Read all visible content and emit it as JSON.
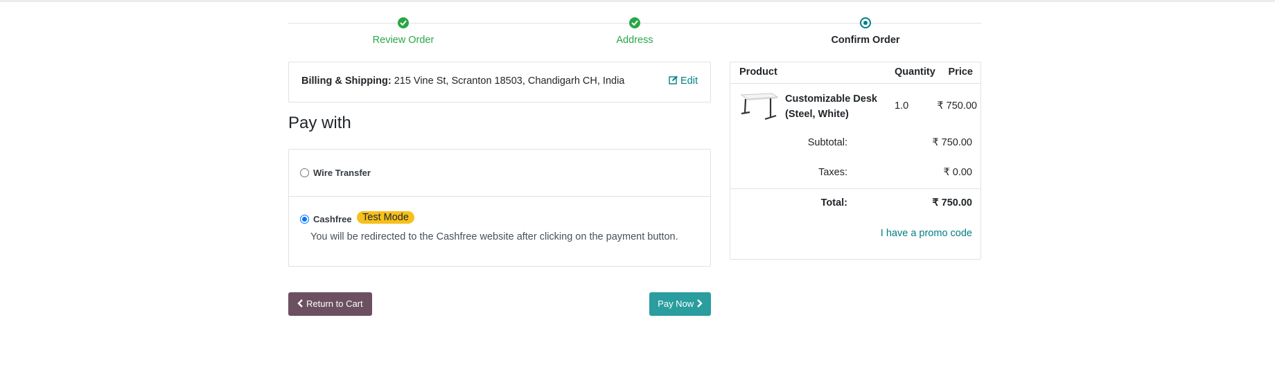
{
  "wizard": {
    "steps": [
      {
        "label": "Review Order",
        "state": "done"
      },
      {
        "label": "Address",
        "state": "done"
      },
      {
        "label": "Confirm Order",
        "state": "current"
      }
    ]
  },
  "billing": {
    "label": "Billing & Shipping:",
    "address": "215 Vine St, Scranton 18503, Chandigarh CH, India",
    "edit_label": "Edit"
  },
  "payment": {
    "title": "Pay with",
    "methods": [
      {
        "name": "Wire Transfer",
        "selected": false
      },
      {
        "name": "Cashfree",
        "selected": true,
        "badge": "Test Mode",
        "description": "You will be redirected to the Cashfree website after clicking on the payment button."
      }
    ]
  },
  "actions": {
    "return_label": "Return to Cart",
    "pay_label": "Pay Now"
  },
  "summary": {
    "headers": {
      "product": "Product",
      "quantity": "Quantity",
      "price": "Price"
    },
    "line": {
      "name": "Customizable Desk (Steel, White)",
      "quantity": "1.0",
      "price": "₹ 750.00"
    },
    "subtotal_label": "Subtotal:",
    "subtotal_value": "₹ 750.00",
    "taxes_label": "Taxes:",
    "taxes_value": "₹ 0.00",
    "total_label": "Total:",
    "total_value": "₹ 750.00",
    "promo_label": "I have a promo code"
  },
  "colors": {
    "done": "#28a745",
    "primary": "#017e84",
    "return_button": "#6c5061",
    "pay_button": "#2a9d9f",
    "badge": "#f6c01c"
  },
  "icons": {
    "step_done": "check-circle-icon",
    "step_current": "current-step-dot-icon",
    "edit": "edit-icon",
    "back": "chevron-left-icon",
    "forward": "chevron-right-icon"
  }
}
